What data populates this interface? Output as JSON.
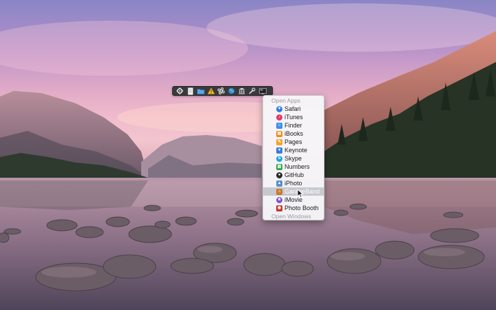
{
  "toolbar": {
    "buttons": [
      {
        "name": "gear-icon"
      },
      {
        "name": "document-icon"
      },
      {
        "name": "folder-icon"
      },
      {
        "name": "warning-icon"
      },
      {
        "name": "command-icon"
      },
      {
        "name": "globe-icon"
      },
      {
        "name": "bank-icon"
      },
      {
        "name": "wrench-icon"
      },
      {
        "name": "screen-icon"
      }
    ]
  },
  "menu": {
    "open_apps_header": "Open Apps",
    "open_windows_header": "Open Windows",
    "items": [
      {
        "label": "Safari",
        "icon": "safari-icon",
        "color": "#2f7fe0"
      },
      {
        "label": "iTunes",
        "icon": "itunes-icon",
        "color": "#e0396b"
      },
      {
        "label": "Finder",
        "icon": "finder-icon",
        "color": "#3e8fe6"
      },
      {
        "label": "iBooks",
        "icon": "ibooks-icon",
        "color": "#f08a1c"
      },
      {
        "label": "Pages",
        "icon": "pages-icon",
        "color": "#f4a42a"
      },
      {
        "label": "Keynote",
        "icon": "keynote-icon",
        "color": "#3a7ed8"
      },
      {
        "label": "Skype",
        "icon": "skype-icon",
        "color": "#1ea2e4"
      },
      {
        "label": "Numbers",
        "icon": "numbers-icon",
        "color": "#35a853"
      },
      {
        "label": "GitHub",
        "icon": "github-icon",
        "color": "#2b2b2b"
      },
      {
        "label": "iPhoto",
        "icon": "iphoto-icon",
        "color": "#5a8fd0"
      },
      {
        "label": "GarageBand",
        "icon": "garageband-icon",
        "color": "#c97a2a"
      },
      {
        "label": "iMovie",
        "icon": "imovie-icon",
        "color": "#7a55c8"
      },
      {
        "label": "Photo Booth",
        "icon": "photobooth-icon",
        "color": "#c8342e"
      }
    ]
  }
}
